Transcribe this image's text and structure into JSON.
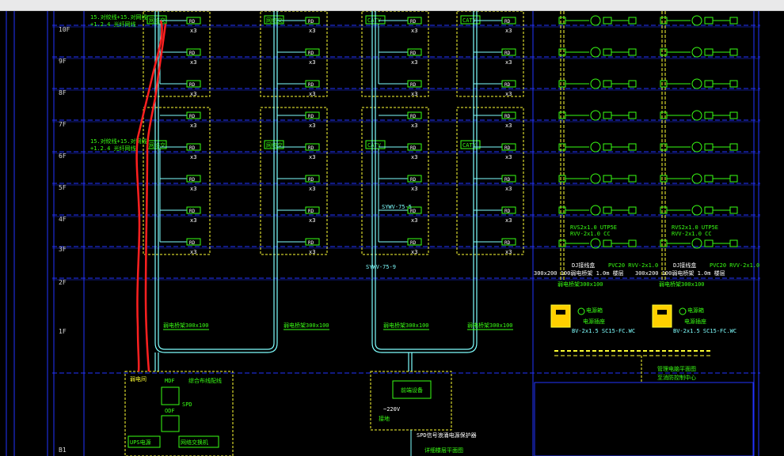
{
  "floors": [
    "10F",
    "9F",
    "8F",
    "7F",
    "6F",
    "5F",
    "4F",
    "3F",
    "2F",
    "1F",
    "B1"
  ],
  "outlet_label": "RD",
  "count_label": "x3",
  "columns": [
    {
      "box_label": "网络交"
    },
    {
      "box_label": "网络交"
    },
    {
      "box_label": "CATV"
    },
    {
      "box_label": "CATV"
    }
  ],
  "cable_note_line1": "15.对绞线+15.对网线",
  "cable_note_line2": "+1.2.4 光纤网线",
  "tray_labels": [
    "弱电桥架300x100",
    "弱电桥架300x100",
    "弱电桥架300x100",
    "弱电桥架300x100"
  ],
  "catv_cable_upper": "SYWV-75-5",
  "catv_cable_lower": "SYWV-75-9",
  "telephone": {
    "cable_a": "RVS2x1.0 UTP5E",
    "cable_b": "RVV-2x1.0 CC",
    "pipe_a": "PVC20 RVV-2x1.0",
    "junction_box": "DJ接线盒",
    "tray": "300x200 100弱电桥架 1.0m 楼层",
    "tray_short": "弱电桥架300x100",
    "power_line": "BV-2x1.5 SC15-FC.WC",
    "power_label": "电源箱",
    "power_sub": "电源插座",
    "bus_label": "管理电脑平面图",
    "bus_sub": "至消防控制中心"
  },
  "equipment_room": {
    "title": "弱电间",
    "mdf": "MDF",
    "odf": "ODF",
    "panel": "综合布线配线",
    "spd": "SPD",
    "ups": "UPS电源",
    "switch": "网络交换机"
  },
  "catv_room": {
    "box": "前端设备",
    "voltage": "~220V",
    "ground": "接地",
    "spd_note": "SPD信号浪涌电源保护器",
    "plan_note": "详细楼层平面图"
  }
}
